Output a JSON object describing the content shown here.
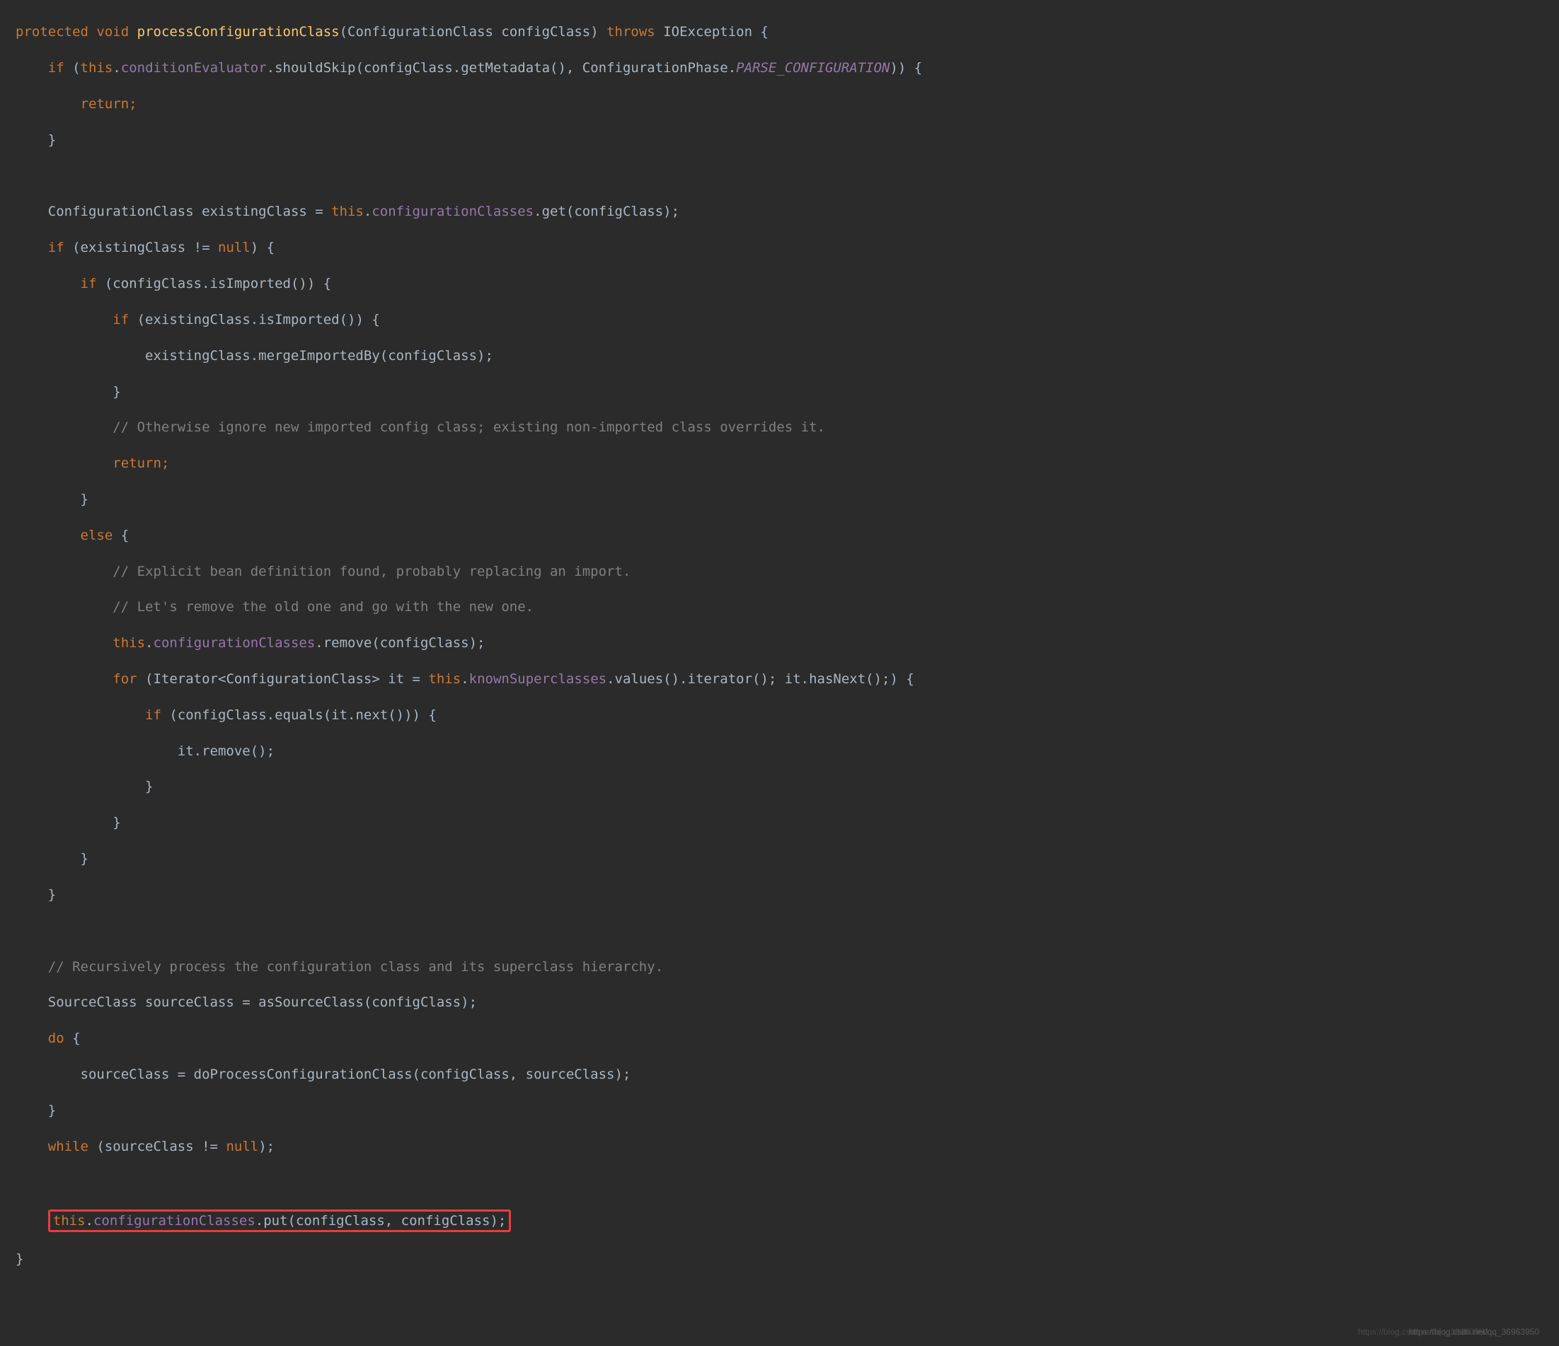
{
  "code": {
    "l01a": "protected",
    "l01b": "void",
    "l01c": "processConfigurationClass",
    "l01d": "(ConfigurationClass configClass) ",
    "l01e": "throws",
    "l01f": " IOException {",
    "l02a": "    ",
    "l02b": "if",
    "l02c": " (",
    "l02d": "this",
    "l02e": ".",
    "l02f": "conditionEvaluator",
    "l02g": ".shouldSkip(configClass.getMetadata(), ConfigurationPhase.",
    "l02h": "PARSE_CONFIGURATION",
    "l02i": ")) {",
    "l03a": "        ",
    "l03b": "return",
    "l03c": ";",
    "l04a": "    }",
    "l05a": "",
    "l06a": "    ConfigurationClass existingClass = ",
    "l06b": "this",
    "l06c": ".",
    "l06d": "configurationClasses",
    "l06e": ".get(configClass);",
    "l07a": "    ",
    "l07b": "if",
    "l07c": " (existingClass != ",
    "l07d": "null",
    "l07e": ") {",
    "l08a": "        ",
    "l08b": "if",
    "l08c": " (configClass.isImported()) {",
    "l09a": "            ",
    "l09b": "if",
    "l09c": " (existingClass.isImported()) {",
    "l10a": "                existingClass.mergeImportedBy(configClass);",
    "l11a": "            }",
    "l12a": "            ",
    "l12b": "// Otherwise ignore new imported config class; existing non-imported class overrides it.",
    "l13a": "            ",
    "l13b": "return",
    "l13c": ";",
    "l14a": "        }",
    "l15a": "        ",
    "l15b": "else",
    "l15c": " {",
    "l16a": "            ",
    "l16b": "// Explicit bean definition found, probably replacing an import.",
    "l17a": "            ",
    "l17b": "// Let's remove the old one and go with the new one.",
    "l18a": "            ",
    "l18b": "this",
    "l18c": ".",
    "l18d": "configurationClasses",
    "l18e": ".remove(configClass);",
    "l19a": "            ",
    "l19b": "for",
    "l19c": " (Iterator<ConfigurationClass> it = ",
    "l19d": "this",
    "l19e": ".",
    "l19f": "knownSuperclasses",
    "l19g": ".values().iterator(); it.hasNext();) {",
    "l20a": "                ",
    "l20b": "if",
    "l20c": " (configClass.equals(it.next())) {",
    "l21a": "                    it.remove();",
    "l22a": "                }",
    "l23a": "            }",
    "l24a": "        }",
    "l25a": "    }",
    "l26a": "",
    "l27a": "    ",
    "l27b": "// Recursively process the configuration class and its superclass hierarchy.",
    "l28a": "    SourceClass sourceClass = asSourceClass(configClass);",
    "l29a": "    ",
    "l29b": "do",
    "l29c": " {",
    "l30a": "        sourceClass = doProcessConfigurationClass(configClass, sourceClass);",
    "l31a": "    }",
    "l32a": "    ",
    "l32b": "while",
    "l32c": " (sourceClass != ",
    "l32d": "null",
    "l32e": ");",
    "l33a": "",
    "l34pad": "    ",
    "l34a": "this",
    "l34b": ".",
    "l34c": "configurationClasses",
    "l34d": ".put(configClass, configClass);",
    "l35a": "}"
  },
  "watermark1": "https://blog.csdn.net/qq_36963950",
  "watermark2": "https://blog.csdn.net/qq_36963950"
}
